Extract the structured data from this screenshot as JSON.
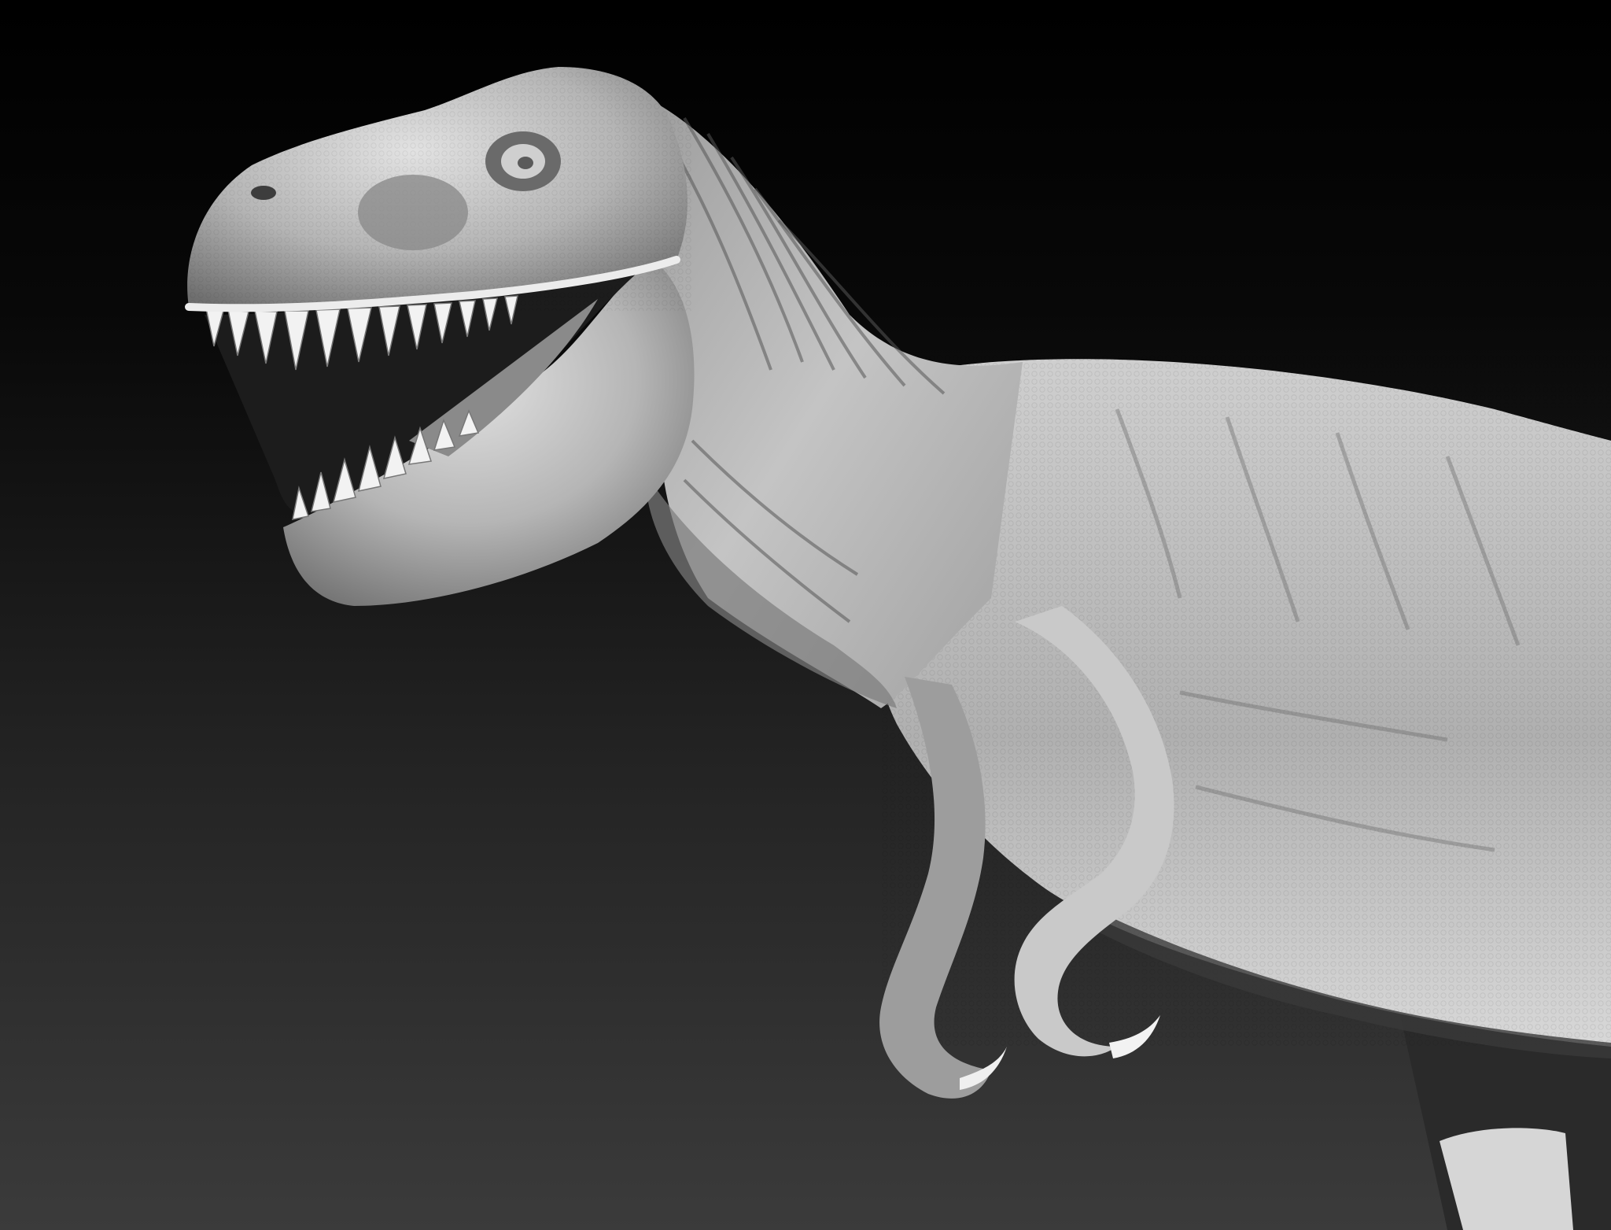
{
  "scene": {
    "subject": "tyrannosaurus-rex-sculpt",
    "render_style": "grayscale-clay",
    "colors": {
      "background_top": "#000000",
      "background_mid": "#1a1a1a",
      "background_bottom": "#3b3b3b",
      "skin_light": "#d9d9d9",
      "skin_mid": "#a6a6a6",
      "skin_shadow": "#5a5a5a",
      "mouth_dark": "#1c1c1c",
      "tooth": "#f2f2f2"
    }
  }
}
